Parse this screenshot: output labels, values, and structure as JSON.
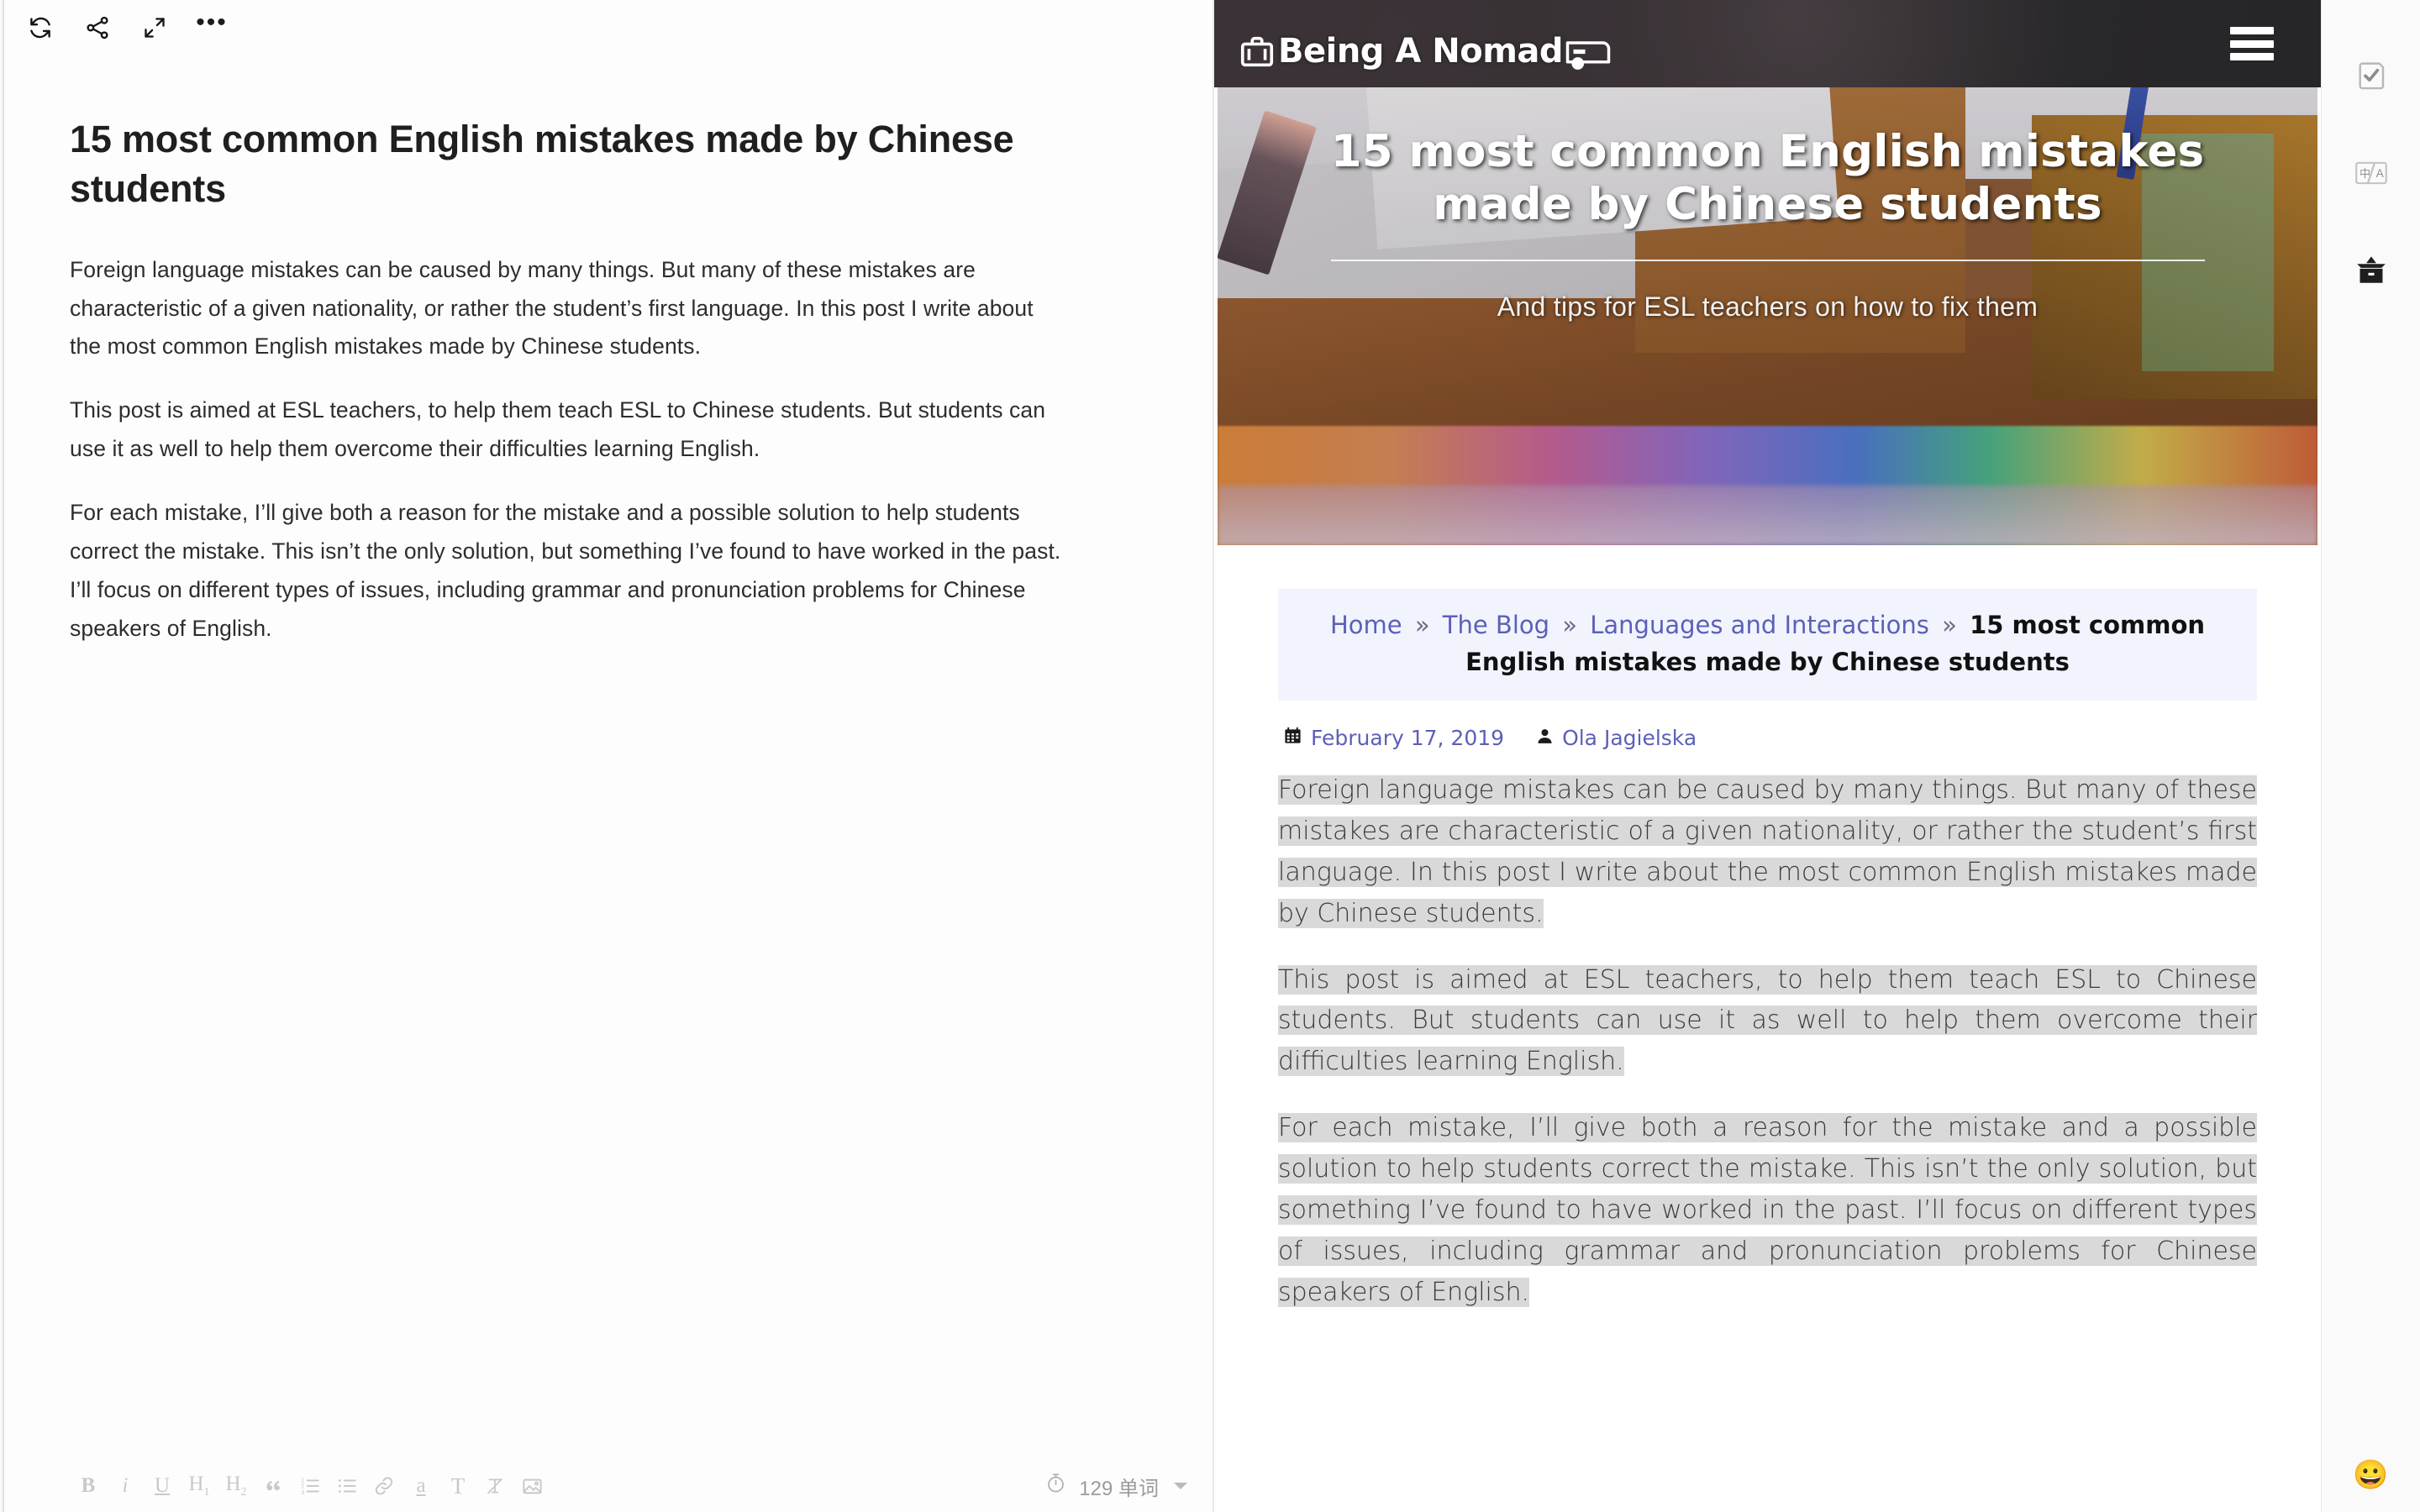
{
  "editor": {
    "toolbar_top": [
      {
        "name": "sync-icon",
        "label": "Sync"
      },
      {
        "name": "share-icon",
        "label": "Share"
      },
      {
        "name": "fullscreen-icon",
        "label": "Fullscreen"
      },
      {
        "name": "more-options-icon",
        "label": "More"
      }
    ],
    "title": "15 most common English mistakes made by Chinese students",
    "paragraphs": [
      "Foreign language mistakes can be caused by many things. But many of these mistakes are characteristic of a given nationality, or rather the student’s first language. In this post I write about the most common English mistakes made by Chinese students.",
      "This post is aimed at ESL teachers, to help them teach ESL to Chinese students. But students can use it as well to help them overcome their difficulties learning English.",
      "For each mistake, I’ll give both a reason for the mistake and a possible solution to help students correct the mistake. This isn’t the only solution, but something I’ve found to have worked in the past. I’ll focus on different types of issues, including grammar and pronunciation problems for Chinese speakers of English."
    ],
    "format_buttons": [
      {
        "name": "bold-button",
        "label": "B"
      },
      {
        "name": "italic-button",
        "label": "i"
      },
      {
        "name": "underline-button",
        "label": "U"
      },
      {
        "name": "heading1-button",
        "label": "H1"
      },
      {
        "name": "heading2-button",
        "label": "H2"
      },
      {
        "name": "blockquote-button",
        "label": "“"
      },
      {
        "name": "ordered-list-button",
        "label": "ordered-list"
      },
      {
        "name": "unordered-list-button",
        "label": "unordered-list"
      },
      {
        "name": "link-button",
        "label": "link"
      },
      {
        "name": "highlight-button",
        "label": "a"
      },
      {
        "name": "text-style-button",
        "label": "T"
      },
      {
        "name": "clear-format-button",
        "label": "clear"
      },
      {
        "name": "insert-image-button",
        "label": "image"
      }
    ],
    "word_count": "129 单词"
  },
  "preview": {
    "site_logo": "Being A Nomad",
    "hero": {
      "title": "15 most common English mistakes made by Chinese students",
      "subtitle": "And tips for ESL teachers on how to fix them"
    },
    "breadcrumb": {
      "items": [
        "Home",
        "The Blog",
        "Languages and Interactions"
      ],
      "separator": "»",
      "current": "15 most common English mistakes made by Chinese students"
    },
    "meta": {
      "date": "February 17, 2019",
      "author": "Ola Jagielska"
    },
    "paragraphs": [
      "Foreign language mistakes can be caused by many things. But many of these mistakes are characteristic of a given nationality, or rather the student’s first language. In this post I write about the most common English mistakes made by Chinese students.",
      "This post is aimed at ESL teachers, to help them teach ESL to Chinese students. But students can use it as well to help them overcome their difficulties learning English.",
      "For each mistake, I’ll give both a reason for the mistake and a possible solution to help students correct the mistake. This isn’t the only solution, but something I’ve found to have worked in the past. I’ll focus on different types of issues, including grammar and pronunciation problems for Chinese speakers of English."
    ]
  },
  "right_rail": {
    "items": [
      {
        "name": "proofread-icon",
        "label": "Proofread"
      },
      {
        "name": "translate-icon",
        "label": "Translate"
      },
      {
        "name": "archive-icon",
        "label": "Archive"
      }
    ],
    "emoji": "😀"
  },
  "colors": {
    "header_bg": "#2d2c2e",
    "breadcrumb_bg": "#f1f4fd",
    "link": "#5c5fb8",
    "selection": "#d9d9d9",
    "toolbar_icon": "#c9c9cc"
  }
}
